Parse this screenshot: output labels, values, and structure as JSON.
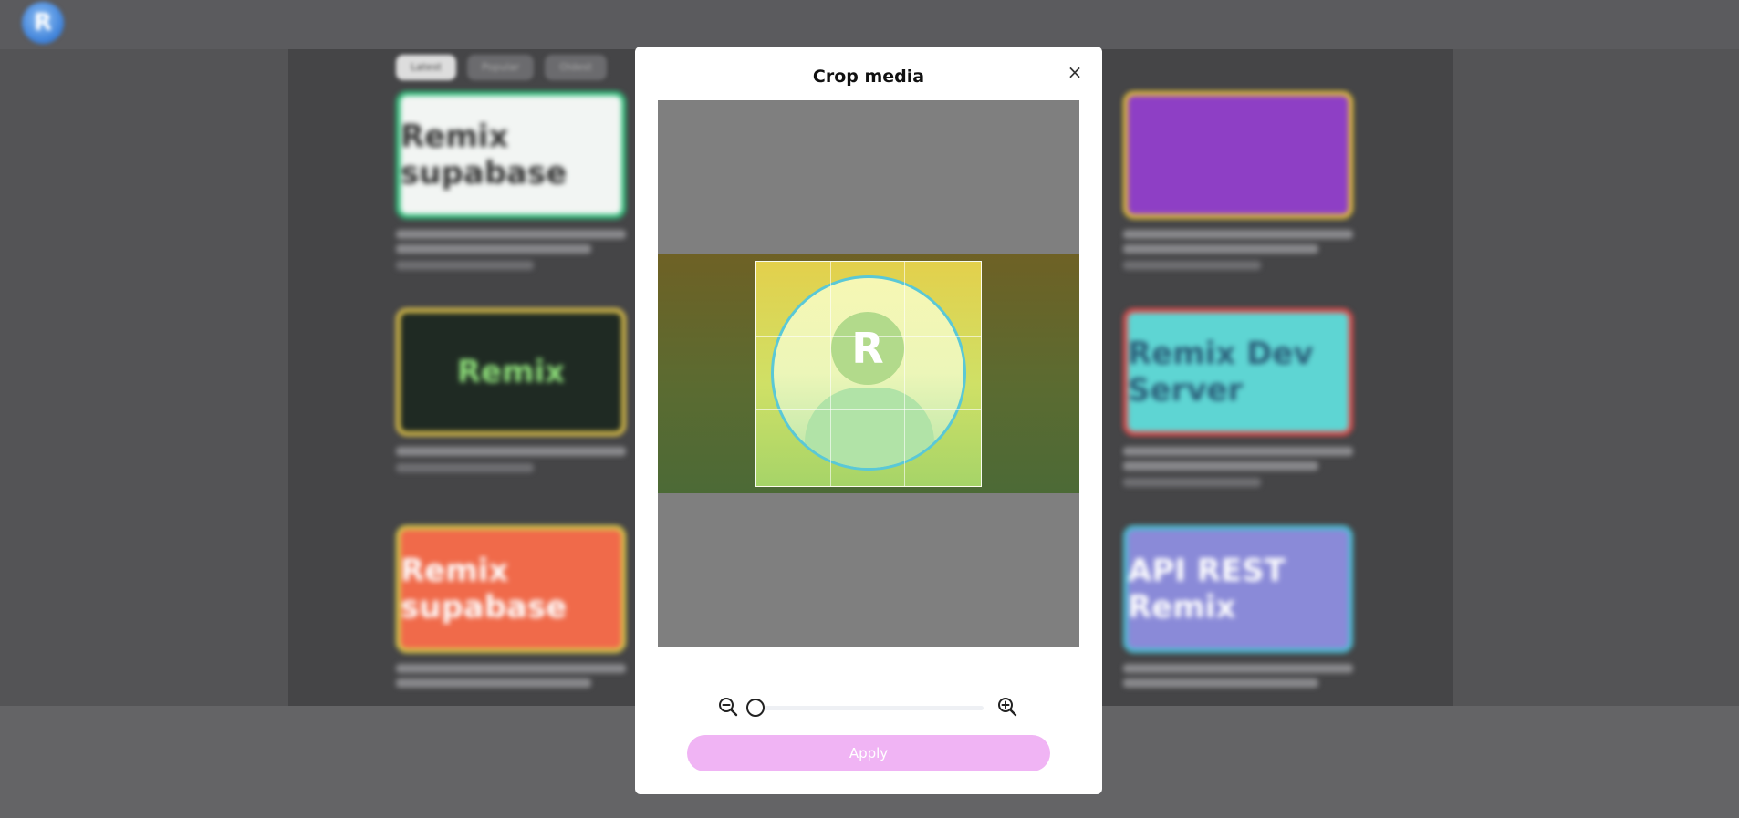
{
  "background": {
    "logo_letter": "R",
    "chips": [
      "Latest",
      "Popular",
      "Oldest"
    ],
    "cards": [
      {
        "thumb_text": "Remix supabase",
        "colors": [
          "#2fbf7a",
          "#f2f5f3",
          "#333"
        ]
      },
      {
        "thumb_text": "",
        "colors": [
          "#e6c23a",
          "#8e3fc5",
          "#fff"
        ]
      },
      {
        "thumb_text": "Remix",
        "colors": [
          "#e0c34a",
          "#1f2a23",
          "#8ee07a"
        ]
      },
      {
        "thumb_text": "Remix Dev Server",
        "colors": [
          "#e04a4a",
          "#5ed5d3",
          "#2b5f7a"
        ]
      },
      {
        "thumb_text": "Remix supabase",
        "colors": [
          "#d9c84a",
          "#f06a4a",
          "#fff"
        ]
      },
      {
        "thumb_text": "API REST Remix",
        "colors": [
          "#4bbbd0",
          "#8a8ad8",
          "#fff"
        ]
      }
    ]
  },
  "modal": {
    "title": "Crop media",
    "close_label": "×",
    "apply_label": "Apply",
    "zoom_level": 0,
    "avatar_letter": "R",
    "colors": {
      "apply_button": "#f0b4f4",
      "avatar_ring": "#5ac8d6"
    },
    "icons": {
      "zoom_out": "zoom-out-icon",
      "zoom_in": "zoom-in-icon",
      "close": "close-icon"
    }
  }
}
